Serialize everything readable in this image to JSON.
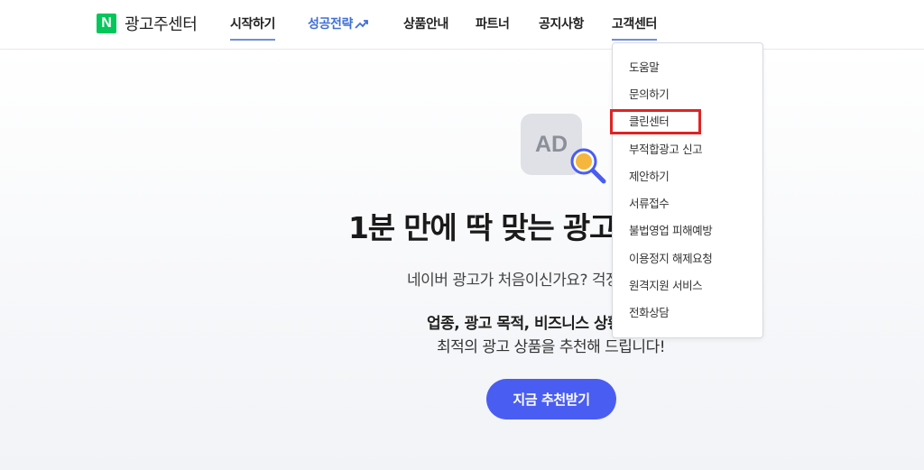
{
  "header": {
    "logo_mark": "N",
    "logo_text": "광고주센터",
    "nav": [
      {
        "label": "시작하기"
      },
      {
        "label": "성공전략"
      },
      {
        "label": "상품안내"
      },
      {
        "label": "파트너"
      },
      {
        "label": "공지사항"
      },
      {
        "label": "고객센터"
      }
    ],
    "brand_color": "#03c75a",
    "accent_color": "#3f6fd6"
  },
  "dropdown": {
    "items": [
      {
        "label": "도움말"
      },
      {
        "label": "문의하기"
      },
      {
        "label": "클린센터"
      },
      {
        "label": "부적합광고 신고"
      },
      {
        "label": "제안하기"
      },
      {
        "label": "서류접수"
      },
      {
        "label": "불법영업 피해예방"
      },
      {
        "label": "이용정지 해제요청"
      },
      {
        "label": "원격지원 서비스"
      },
      {
        "label": "전화상담"
      }
    ],
    "highlighted_item": "클린센터",
    "highlight_color": "#e12323"
  },
  "hero": {
    "icon_text": "AD",
    "title": "1분 만에 딱 맞는 광고",
    "subtitle": "네이버 광고가 처음이신가요? 걱정",
    "bold_line": "업종, 광고 목적, 비즈니스 상황",
    "line2": "최적의 광고 상품을 추천해 드립니다!",
    "cta_label": "지금 추천받기",
    "cta_color": "#4a5df2"
  }
}
